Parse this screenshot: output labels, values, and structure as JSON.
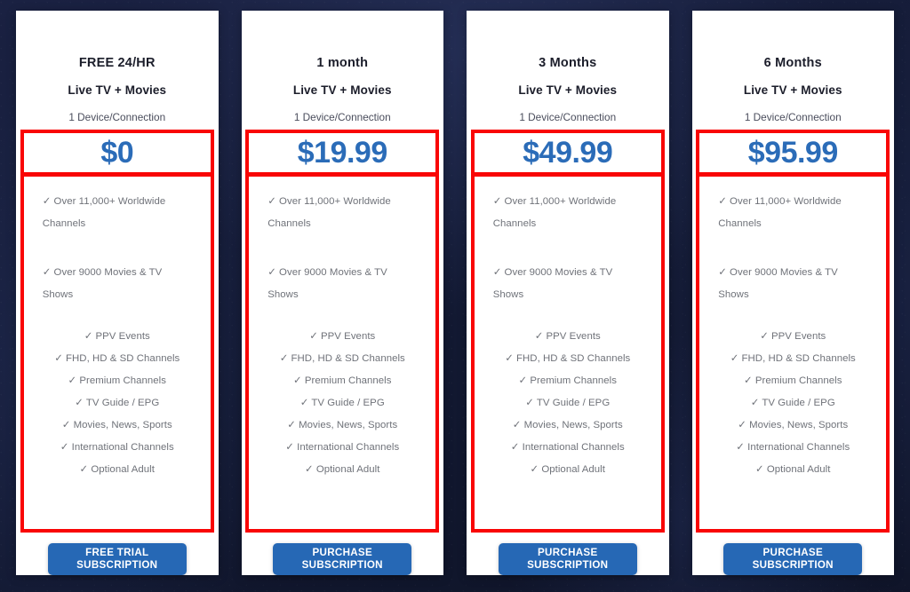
{
  "theme": {
    "background_dark": "#141a33",
    "card_background": "#ffffff",
    "price_blue": "#2b6cb8",
    "button_blue": "#2668b5",
    "annotation_red": "#f90505",
    "feature_text": "#6f7279",
    "heading_text": "#1b1d2a"
  },
  "plans": [
    {
      "title": "FREE 24/HR",
      "subtitle": "Live TV + Movies",
      "devices": "1 Device/Connection",
      "price": "$0",
      "features_wide": [
        "✓ Over 11,000+ Worldwide Channels",
        "✓ Over 9000 Movies & TV Shows"
      ],
      "features_center": [
        "✓ PPV Events",
        "✓ FHD, HD & SD Channels",
        "✓ Premium Channels",
        "✓ TV Guide / EPG",
        "✓ Movies, News, Sports",
        "✓ International Channels",
        "✓ Optional Adult"
      ],
      "cta_line1": "FREE TRIAL",
      "cta_line2": "SUBSCRIPTION"
    },
    {
      "title": "1 month",
      "subtitle": "Live TV + Movies",
      "devices": "1 Device/Connection",
      "price": "$19.99",
      "features_wide": [
        "✓ Over 11,000+ Worldwide Channels",
        "✓ Over 9000 Movies & TV Shows"
      ],
      "features_center": [
        "✓ PPV Events",
        "✓ FHD, HD & SD Channels",
        "✓ Premium Channels",
        "✓ TV Guide / EPG",
        "✓ Movies, News, Sports",
        "✓ International Channels",
        "✓ Optional Adult"
      ],
      "cta_line1": "PURCHASE",
      "cta_line2": "SUBSCRIPTION"
    },
    {
      "title": "3 Months",
      "subtitle": "Live TV + Movies",
      "devices": "1 Device/Connection",
      "price": "$49.99",
      "features_wide": [
        "✓ Over 11,000+ Worldwide Channels",
        "✓ Over 9000 Movies & TV Shows"
      ],
      "features_center": [
        "✓ PPV Events",
        "✓ FHD, HD & SD Channels",
        "✓ Premium Channels",
        "✓ TV Guide / EPG",
        "✓ Movies, News, Sports",
        "✓ International Channels",
        "✓ Optional Adult"
      ],
      "cta_line1": "PURCHASE",
      "cta_line2": "SUBSCRIPTION"
    },
    {
      "title": "6 Months",
      "subtitle": "Live TV + Movies",
      "devices": "1 Device/Connection",
      "price": "$95.99",
      "features_wide": [
        "✓ Over 11,000+ Worldwide Channels",
        "✓ Over 9000 Movies & TV Shows"
      ],
      "features_center": [
        "✓ PPV Events",
        "✓ FHD, HD & SD Channels",
        "✓ Premium Channels",
        "✓ TV Guide / EPG",
        "✓ Movies, News, Sports",
        "✓ International Channels",
        "✓ Optional Adult"
      ],
      "cta_line1": "PURCHASE",
      "cta_line2": "SUBSCRIPTION"
    }
  ]
}
